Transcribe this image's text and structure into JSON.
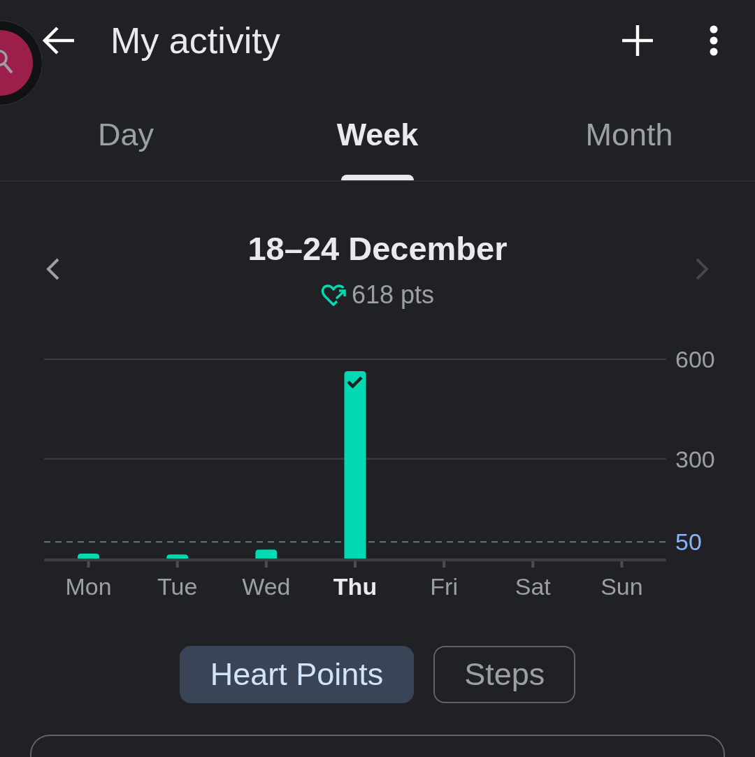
{
  "app_bar": {
    "title": "My activity"
  },
  "tabs": [
    {
      "label": "Day",
      "selected": false
    },
    {
      "label": "Week",
      "selected": true
    },
    {
      "label": "Month",
      "selected": false
    }
  ],
  "period": {
    "title": "18–24 December",
    "points": "618 pts",
    "previous": {
      "disabled": false
    },
    "next": {
      "disabled": true
    }
  },
  "chart": {
    "days": [
      {
        "selected": false,
        "goal_met": false
      },
      {
        "selected": false,
        "goal_met": false
      },
      {
        "selected": false,
        "goal_met": false
      },
      {
        "selected": true,
        "goal_met": true
      },
      {
        "selected": false
      },
      {
        "selected": false
      },
      {
        "selected": false
      }
    ],
    "chart_data": {
      "type": "bar",
      "categories": [
        "Mon",
        "Tue",
        "Wed",
        "Thu",
        "Fri",
        "Sat",
        "Sun"
      ],
      "values": [
        15,
        12,
        27,
        564,
        null,
        null,
        null
      ],
      "ylim": [
        0,
        600
      ],
      "yticks": [
        300,
        600
      ],
      "ref_lines": [
        {
          "axis": "y",
          "value": 50,
          "label": "50"
        }
      ]
    }
  },
  "metric_chips": [
    {
      "label": "Heart Points",
      "selected": true
    },
    {
      "label": "Steps",
      "selected": false
    }
  ]
}
